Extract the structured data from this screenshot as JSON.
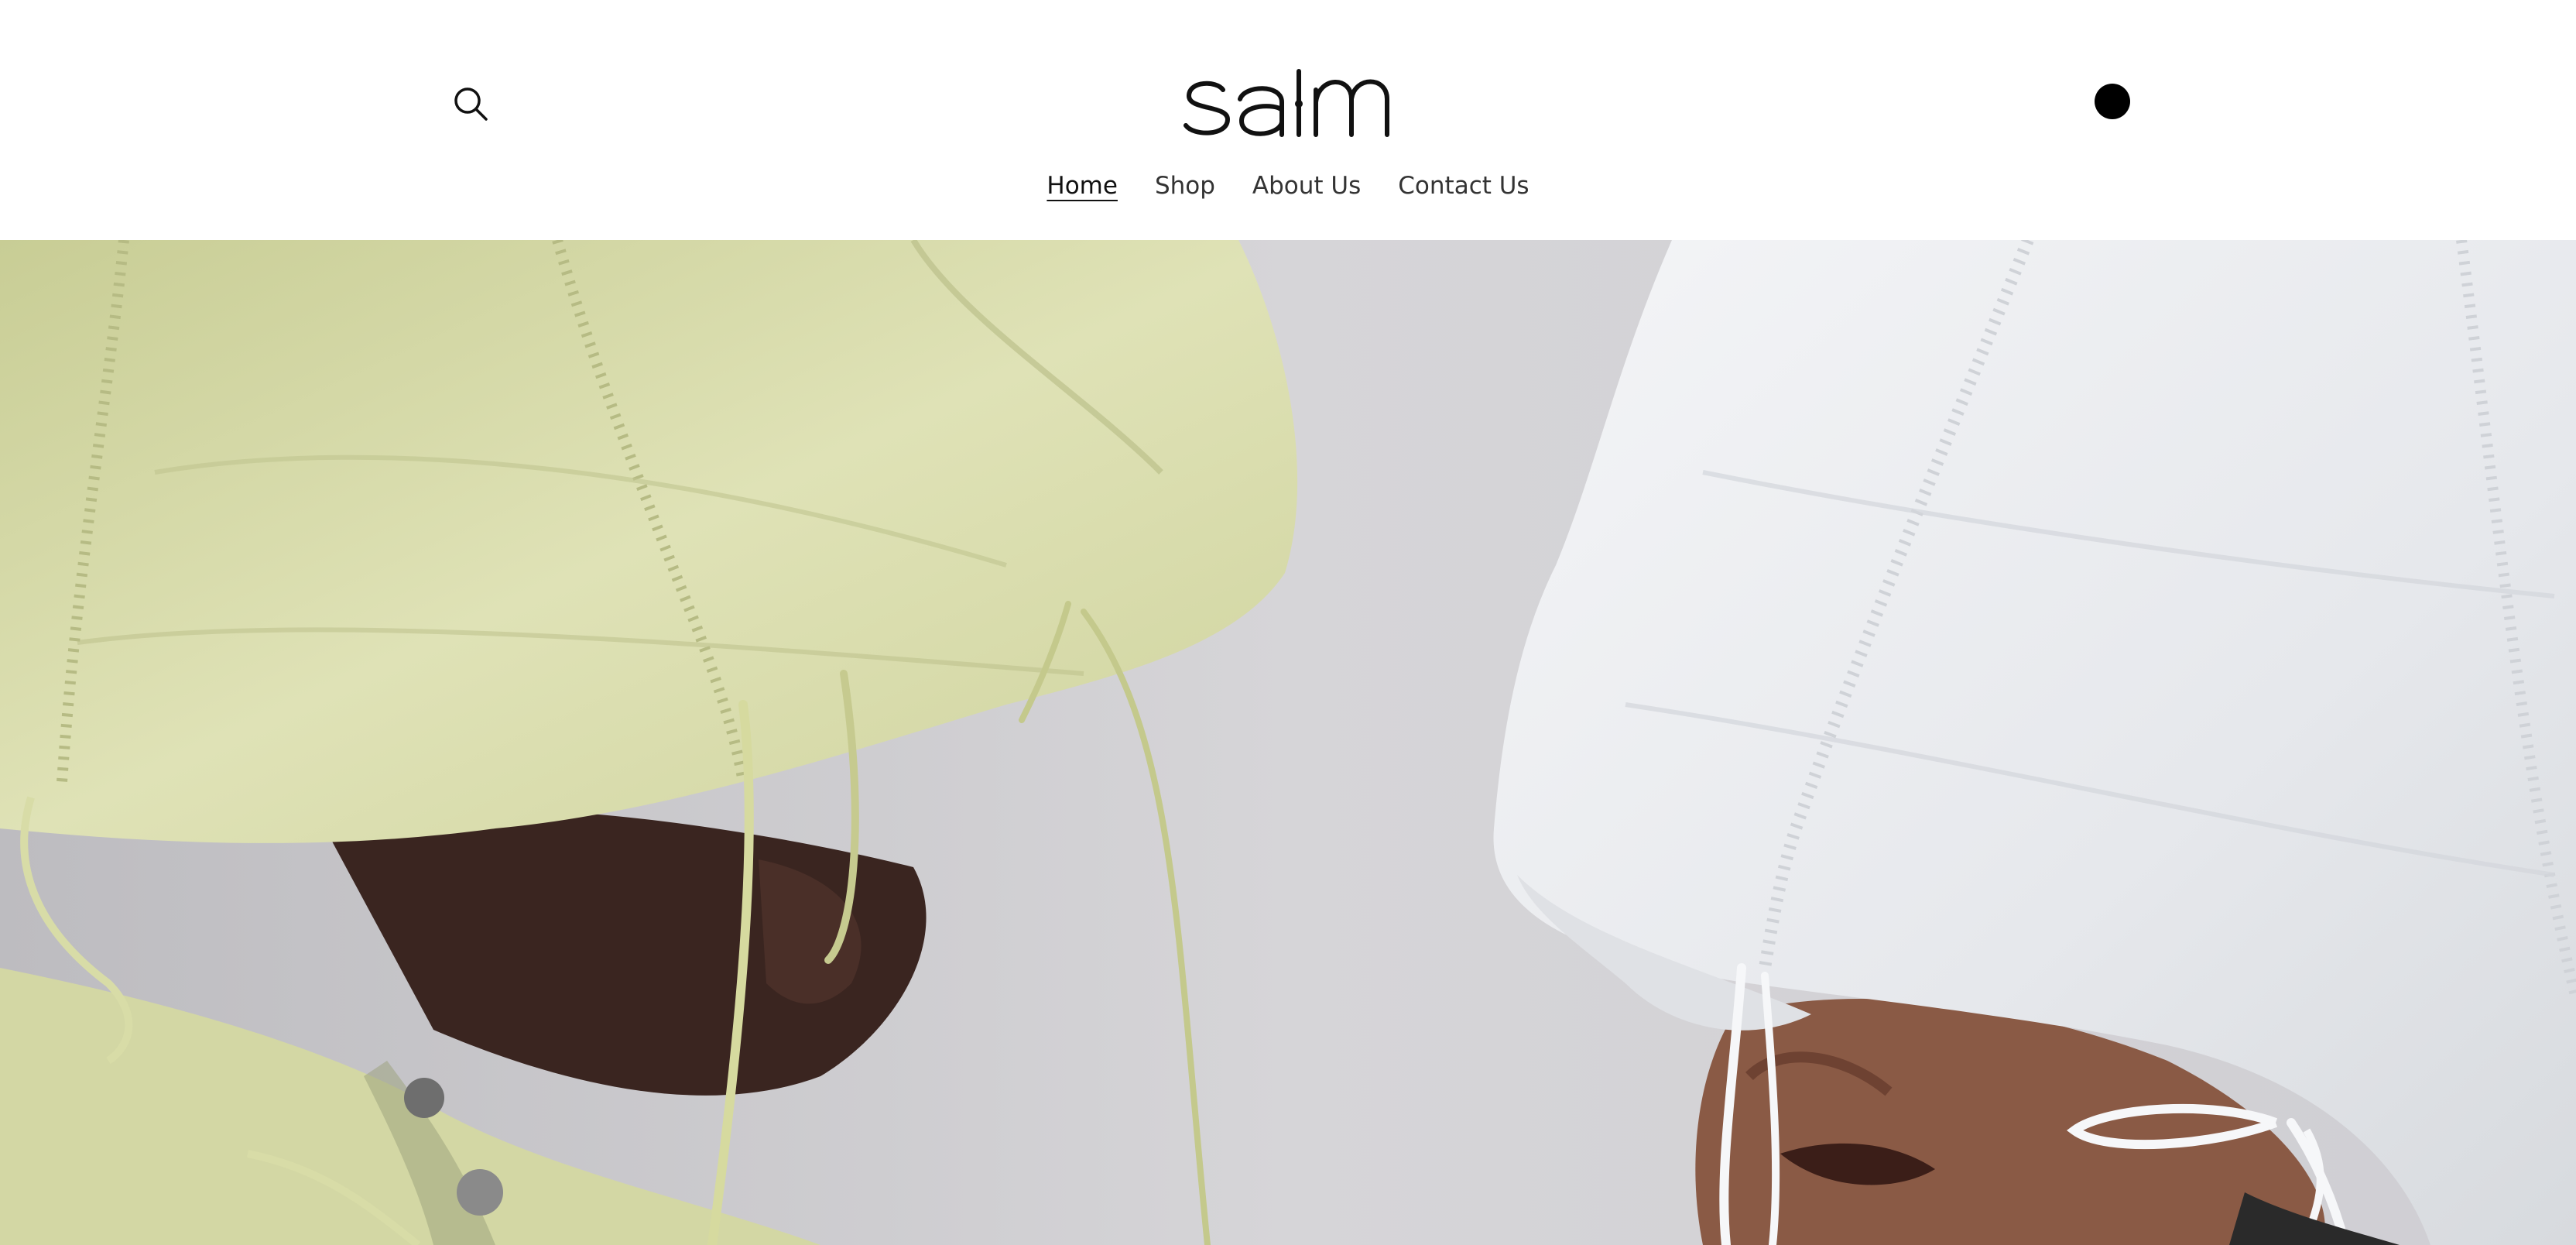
{
  "header": {
    "brand": "saim",
    "search_icon": "search-icon",
    "cart_icon": "cart-dot-icon"
  },
  "nav": {
    "items": [
      {
        "label": "Home",
        "active": true
      },
      {
        "label": "Shop",
        "active": false
      },
      {
        "label": "About Us",
        "active": false
      },
      {
        "label": "Contact Us",
        "active": false
      }
    ]
  },
  "hero": {
    "image": "hero-photo",
    "colors": {
      "background": "#c9c8cc",
      "green_hood": "#d8dcae",
      "white_hood": "#eceef2",
      "skin_dark": "#3a2520",
      "skin_light": "#8a5a45"
    }
  }
}
